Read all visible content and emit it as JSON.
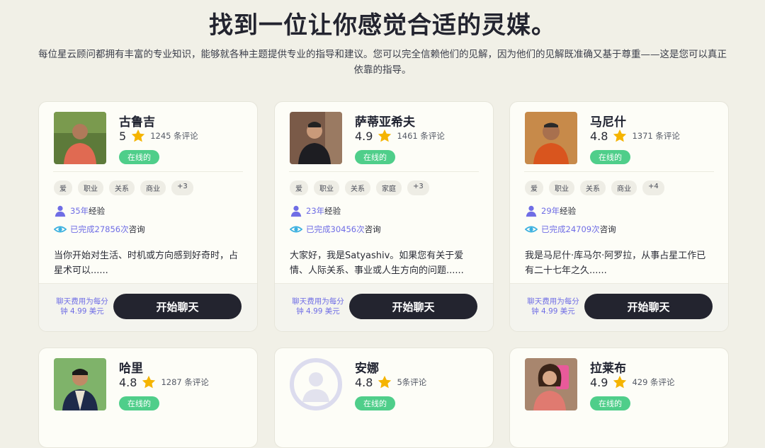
{
  "header": {
    "title": "找到一位让你感觉合适的灵媒。",
    "description": "每位星云顾问都拥有丰富的专业知识，能够就各种主题提供专业的指导和建议。您可以完全信赖他们的见解，因为他们的见解既准确又基于尊重——这是您可以真正依靠的指导。"
  },
  "colors": {
    "accent": "#6f6de5",
    "online": "#4fce8a",
    "button": "#23242f",
    "star": "#f5b400"
  },
  "advisors": [
    {
      "name": "古鲁吉",
      "rating": "5",
      "reviews": "1245 条评论",
      "status": "在线的",
      "tags": [
        "爱",
        "职业",
        "关系",
        "商业",
        "+3"
      ],
      "experience_value": "35年",
      "experience_label": "经验",
      "consult_value": "已完成27856次",
      "consult_label": "咨询",
      "bio": "当你开始对生活、时机或方向感到好奇时，占星术可以......",
      "price": "聊天费用为每分钟 4.99 美元",
      "chat_label": "开始聊天"
    },
    {
      "name": "萨蒂亚希夫",
      "rating": "4.9",
      "reviews": "1461 条评论",
      "status": "在线的",
      "tags": [
        "爱",
        "职业",
        "关系",
        "家庭",
        "+3"
      ],
      "experience_value": "23年",
      "experience_label": "经验",
      "consult_value": "已完成30456次",
      "consult_label": "咨询",
      "bio": "大家好，我是Satyashiv。如果您有关于爱情、人际关系、事业或人生方向的问题......",
      "price": "聊天费用为每分钟 4.99 美元",
      "chat_label": "开始聊天"
    },
    {
      "name": "马尼什",
      "rating": "4.8",
      "reviews": "1371 条评论",
      "status": "在线的",
      "tags": [
        "爱",
        "职业",
        "关系",
        "商业",
        "+4"
      ],
      "experience_value": "29年",
      "experience_label": "经验",
      "consult_value": "已完成24709次",
      "consult_label": "咨询",
      "bio": "我是马尼什·库马尔·阿罗拉，从事占星工作已有二十七年之久......",
      "price": "聊天费用为每分钟 4.99 美元",
      "chat_label": "开始聊天"
    },
    {
      "name": "哈里",
      "rating": "4.8",
      "reviews": "1287 条评论",
      "status": "在线的"
    },
    {
      "name": "安娜",
      "rating": "4.8",
      "reviews": "5条评论",
      "status": "在线的"
    },
    {
      "name": "拉莱布",
      "rating": "4.9",
      "reviews": "429 条评论",
      "status": "在线的"
    }
  ]
}
